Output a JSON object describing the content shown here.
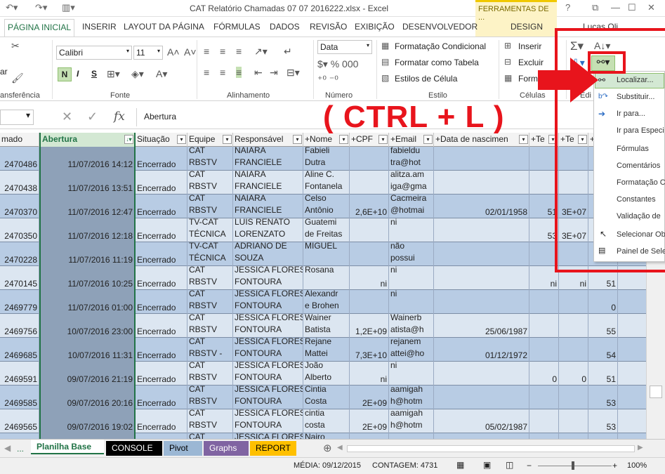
{
  "window": {
    "title": "CAT Relatório Chamadas 07 07 2016222.xlsx - Excel",
    "context_tab_header": "FERRAMENTAS DE ...",
    "context_tab": "DESIGN",
    "help": "?",
    "user": "Lucas Oli"
  },
  "tabs": [
    "PÁGINA INICIAL",
    "INSERIR",
    "LAYOUT DA PÁGINA",
    "FÓRMULAS",
    "DADOS",
    "REVISÃO",
    "EXIBIÇÃO",
    "DESENVOLVEDOR"
  ],
  "ribbon": {
    "font_name": "Calibri",
    "font_size": "11",
    "number_format": "Data",
    "cond_format": "Formatação Condicional",
    "format_table": "Formatar como Tabela",
    "cell_styles": "Estilos de Célula",
    "insert": "Inserir",
    "delete": "Excluir",
    "format": "Forma",
    "bold": "N",
    "italic": "I",
    "underline": "S",
    "groups": {
      "clipboard": "ansferência",
      "font": "Fonte",
      "align": "Alinhamento",
      "number": "Número",
      "styles": "Estilo",
      "cells": "Células",
      "editing": "Edi"
    },
    "left_cut": "ar"
  },
  "formula_bar": {
    "value": "Abertura",
    "fx": "fx"
  },
  "annotation": "( CTRL + L )",
  "find_menu": [
    "Localizar...",
    "Substituir...",
    "Ir para...",
    "Ir para Especi",
    "Fórmulas",
    "Comentários",
    "Formatação C",
    "Constantes",
    "Validação de",
    "Selecionar Ob",
    "Painel de Sele"
  ],
  "columns": [
    "mado",
    "Abertura",
    "Situação",
    "Equipe",
    "Responsável",
    "+Nome",
    "+CPF",
    "+Email",
    "+Data de nascimen",
    "+Te",
    "+Te",
    "+"
  ],
  "rows": [
    {
      "id": "2470486",
      "date": "11/07/2016 14:12",
      "status": "Encerrado",
      "team": [
        "CAT",
        "RBSTV"
      ],
      "resp": [
        "NAIARA",
        "FRANCIELE"
      ],
      "name": [
        "Fabieli",
        "Dutra"
      ],
      "cpf": "",
      "email": [
        "fabieldu",
        "tra@hot"
      ],
      "birth": "",
      "t1": "",
      "t2": "",
      "t3": ""
    },
    {
      "id": "2470438",
      "date": "11/07/2016 13:51",
      "status": "Encerrado",
      "team": [
        "CAT",
        "RBSTV"
      ],
      "resp": [
        "NAIARA",
        "FRANCIELE"
      ],
      "name": [
        "Aline C.",
        "Fontanela"
      ],
      "cpf": "",
      "email": [
        "alitza.am",
        "iga@gma"
      ],
      "birth": "",
      "t1": "",
      "t2": "",
      "t3": ""
    },
    {
      "id": "2470370",
      "date": "11/07/2016 12:47",
      "status": "Encerrado",
      "team": [
        "CAT",
        "RBSTV"
      ],
      "resp": [
        "NAIARA",
        "FRANCIELE"
      ],
      "name": [
        "Celso",
        "Antônio"
      ],
      "cpf": "2,6E+10",
      "email": [
        "Cacmeira",
        "@hotmai"
      ],
      "birth": "02/01/1958",
      "t1": "51",
      "t2": "3E+07",
      "t3": ""
    },
    {
      "id": "2470350",
      "date": "11/07/2016 12:18",
      "status": "Encerrado",
      "team": [
        "TV-CAT",
        "TÉCNICA"
      ],
      "resp": [
        "LUIS RENATO",
        "LORENZATO"
      ],
      "name": [
        "Guatemi",
        "de Freitas"
      ],
      "cpf": "",
      "email": [
        "",
        "ni"
      ],
      "birth": "",
      "t1": "53",
      "t2": "3E+07",
      "t3": ""
    },
    {
      "id": "2470228",
      "date": "11/07/2016 11:19",
      "status": "Encerrado",
      "team": [
        "TV-CAT",
        "TÉCNICA"
      ],
      "resp": [
        "ADRIANO DE",
        "SOUZA"
      ],
      "name": [
        "",
        "MIGUEL"
      ],
      "cpf": "",
      "email": [
        "não",
        "possui"
      ],
      "birth": "",
      "t1": "",
      "t2": "",
      "t3": ""
    },
    {
      "id": "2470145",
      "date": "11/07/2016 10:25",
      "status": "Encerrado",
      "team": [
        "CAT",
        "RBSTV"
      ],
      "resp": [
        "JESSICA FLORES",
        "FONTOURA"
      ],
      "name": [
        "",
        "Rosana"
      ],
      "cpf": "ni",
      "email": [
        "",
        "ni"
      ],
      "birth": "",
      "t1": "ni",
      "t2": "ni",
      "t3": "51"
    },
    {
      "id": "2469779",
      "date": "11/07/2016 01:00",
      "status": "Encerrado",
      "team": [
        "CAT",
        "RBSTV"
      ],
      "resp": [
        "JESSICA FLORES",
        "FONTOURA"
      ],
      "name": [
        "Alexandr",
        "e Brohen"
      ],
      "cpf": "",
      "email": [
        "",
        "ni"
      ],
      "birth": "",
      "t1": "",
      "t2": "",
      "t3": "0"
    },
    {
      "id": "2469756",
      "date": "10/07/2016 23:00",
      "status": "Encerrado",
      "team": [
        "CAT",
        "RBSTV"
      ],
      "resp": [
        "JESSICA FLORES",
        "FONTOURA"
      ],
      "name": [
        "Wainer",
        "Batista"
      ],
      "cpf": "1,2E+09",
      "email": [
        "Wainerb",
        "atista@h"
      ],
      "birth": "25/06/1987",
      "t1": "",
      "t2": "",
      "t3": "55"
    },
    {
      "id": "2469685",
      "date": "10/07/2016 11:31",
      "status": "Encerrado",
      "team": [
        "CAT",
        "RBSTV -"
      ],
      "resp": [
        "JESSICA FLORES",
        "FONTOURA"
      ],
      "name": [
        "Rejane",
        "Mattei"
      ],
      "cpf": "7,3E+10",
      "email": [
        "rejanem",
        "attei@ho"
      ],
      "birth": "01/12/1972",
      "t1": "",
      "t2": "",
      "t3": "54"
    },
    {
      "id": "2469591",
      "date": "09/07/2016 21:19",
      "status": "Encerrado",
      "team": [
        "CAT",
        "RBSTV"
      ],
      "resp": [
        "JESSICA FLORES",
        "FONTOURA"
      ],
      "name": [
        "João",
        "Alberto"
      ],
      "cpf": "ni",
      "email": [
        "",
        "ni"
      ],
      "birth": "",
      "t1": "0",
      "t2": "0",
      "t3": "51"
    },
    {
      "id": "2469585",
      "date": "09/07/2016 20:16",
      "status": "Encerrado",
      "team": [
        "CAT",
        "RBSTV"
      ],
      "resp": [
        "JESSICA FLORES",
        "FONTOURA"
      ],
      "name": [
        "Cintia",
        "Costa"
      ],
      "cpf": "2E+09",
      "email": [
        "aamigah",
        "h@hotm"
      ],
      "birth": "",
      "t1": "",
      "t2": "",
      "t3": "53"
    },
    {
      "id": "2469565",
      "date": "09/07/2016 19:02",
      "status": "Encerrado",
      "team": [
        "CAT",
        "RBSTV"
      ],
      "resp": [
        "JESSICA FLORES",
        "FONTOURA"
      ],
      "name": [
        "cintia",
        "costa"
      ],
      "cpf": "2E+09",
      "email": [
        "aamigah",
        "h@hotm"
      ],
      "birth": "05/02/1987",
      "t1": "",
      "t2": "",
      "t3": "53"
    },
    {
      "id": "",
      "date": "",
      "status": "",
      "team": [
        "CAT",
        ""
      ],
      "resp": [
        "JESSICA FLORES",
        ""
      ],
      "name": [
        "Nairo",
        ""
      ],
      "cpf": "",
      "email": [
        "",
        ""
      ],
      "birth": "",
      "t1": "",
      "t2": "",
      "t3": ""
    }
  ],
  "sheets": {
    "more": "...",
    "tabs": [
      {
        "label": "Planilha Base",
        "bg": "#ffffff",
        "fg": "#217346"
      },
      {
        "label": "CONSOLE",
        "bg": "#000000",
        "fg": "#ffffff"
      },
      {
        "label": "Pivot",
        "bg": "#9bb7d4",
        "fg": "#000000"
      },
      {
        "label": "Graphs",
        "bg": "#8064a2",
        "fg": "#ffffff"
      },
      {
        "label": "REPORT",
        "bg": "#ffc000",
        "fg": "#000000"
      }
    ]
  },
  "status": {
    "media": "MÉDIA: 09/12/2015",
    "contagem": "CONTAGEM: 4731",
    "zoom": "100%"
  },
  "colors": {
    "accent": "#217346",
    "annotation_red": "#e8141c",
    "row_band_a": "#b8cce4",
    "row_band_b": "#dce6f1",
    "selected_col": "#8ea1b8"
  }
}
